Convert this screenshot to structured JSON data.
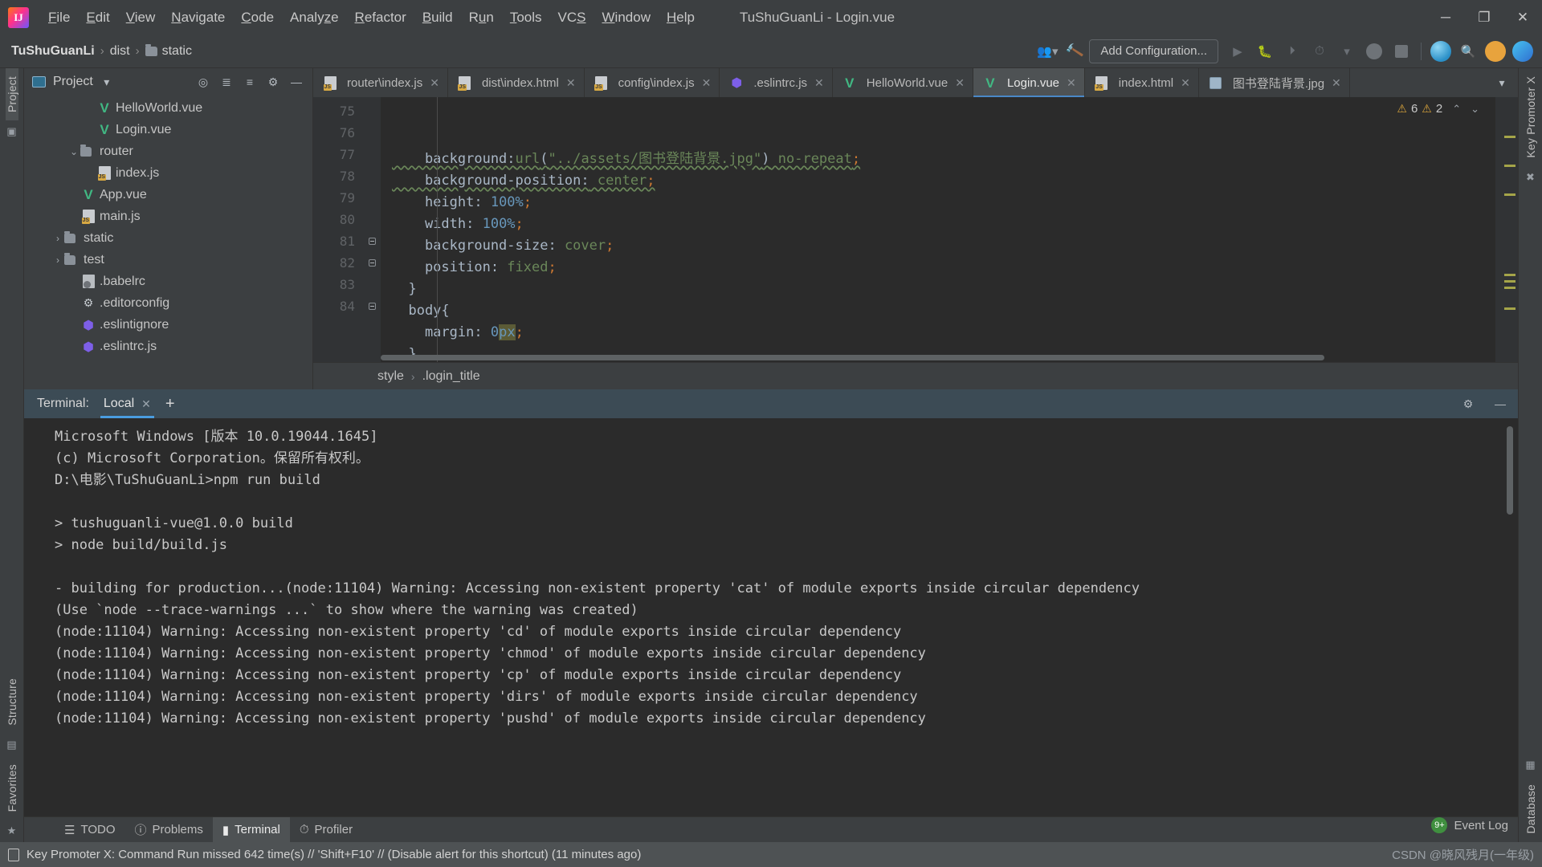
{
  "window": {
    "title": "TuShuGuanLi - Login.vue",
    "logo_text": "IJ",
    "minimize": "─",
    "maximize": "❐",
    "close": "✕"
  },
  "menu": {
    "items": [
      {
        "label": "File",
        "mnemonic": "F"
      },
      {
        "label": "Edit",
        "mnemonic": "E"
      },
      {
        "label": "View",
        "mnemonic": "V"
      },
      {
        "label": "Navigate",
        "mnemonic": "N"
      },
      {
        "label": "Code",
        "mnemonic": "C"
      },
      {
        "label": "Analyze",
        "mnemonic": "z"
      },
      {
        "label": "Refactor",
        "mnemonic": "R"
      },
      {
        "label": "Build",
        "mnemonic": "B"
      },
      {
        "label": "Run",
        "mnemonic": "u"
      },
      {
        "label": "Tools",
        "mnemonic": "T"
      },
      {
        "label": "VCS",
        "mnemonic": "S"
      },
      {
        "label": "Window",
        "mnemonic": "W"
      },
      {
        "label": "Help",
        "mnemonic": "H"
      }
    ]
  },
  "navbar": {
    "crumbs": [
      "TuShuGuanLi",
      "dist",
      "static"
    ],
    "add_configuration": "Add Configuration...",
    "icons": [
      "user-group-icon",
      "hammer-icon",
      "run-icon",
      "debug-icon",
      "coverage-icon",
      "profile-icon",
      "stop-icon",
      "search-icon",
      "update-icon",
      "settings-icon"
    ]
  },
  "left_rail": {
    "items": [
      "Project",
      "Structure",
      "Favorites"
    ]
  },
  "right_rail": {
    "items": [
      "Key Promoter X",
      "Database"
    ]
  },
  "project_panel": {
    "title": "Project",
    "tree": [
      {
        "label": "HelloWorld.vue",
        "icon": "vue-icon",
        "depth": 3,
        "arrow": ""
      },
      {
        "label": "Login.vue",
        "icon": "vue-icon",
        "depth": 3,
        "arrow": ""
      },
      {
        "label": "router",
        "icon": "folder-icon",
        "depth": 2,
        "arrow": "⌄"
      },
      {
        "label": "index.js",
        "icon": "js-icon",
        "depth": 3,
        "arrow": ""
      },
      {
        "label": "App.vue",
        "icon": "vue-icon",
        "depth": 2,
        "arrow": ""
      },
      {
        "label": "main.js",
        "icon": "js-icon",
        "depth": 2,
        "arrow": ""
      },
      {
        "label": "static",
        "icon": "folder-icon",
        "depth": 1,
        "arrow": "›"
      },
      {
        "label": "test",
        "icon": "folder-icon",
        "depth": 1,
        "arrow": "›"
      },
      {
        "label": ".babelrc",
        "icon": "babel-icon",
        "depth": 2,
        "arrow": ""
      },
      {
        "label": ".editorconfig",
        "icon": "gear-icon",
        "depth": 2,
        "arrow": ""
      },
      {
        "label": ".eslintignore",
        "icon": "eslint-icon",
        "depth": 2,
        "arrow": ""
      },
      {
        "label": ".eslintrc.js",
        "icon": "eslint-icon",
        "depth": 2,
        "arrow": ""
      }
    ]
  },
  "editor": {
    "tabs": [
      {
        "label": "router\\index.js",
        "icon": "js-icon",
        "active": false
      },
      {
        "label": "dist\\index.html",
        "icon": "html-icon",
        "active": false
      },
      {
        "label": "config\\index.js",
        "icon": "js-icon",
        "active": false
      },
      {
        "label": ".eslintrc.js",
        "icon": "eslint-icon",
        "active": false
      },
      {
        "label": "HelloWorld.vue",
        "icon": "vue-icon",
        "active": false
      },
      {
        "label": "Login.vue",
        "icon": "vue-icon",
        "active": true
      },
      {
        "label": "index.html",
        "icon": "html-icon",
        "active": false
      },
      {
        "label": "图书登陆背景.jpg",
        "icon": "image-icon",
        "active": false
      }
    ],
    "line_numbers": [
      "75",
      "76",
      "77",
      "78",
      "79",
      "80",
      "81",
      "82",
      "83",
      "84"
    ],
    "code_lines": [
      {
        "n": "75",
        "segments": [
          {
            "t": "    background:",
            "c": "c-prop"
          },
          {
            "t": "url",
            "c": "c-val"
          },
          {
            "t": "(",
            "c": "c-prop"
          },
          {
            "t": "\"../assets/图书登陆背景.jpg\"",
            "c": "c-str"
          },
          {
            "t": ")",
            "c": "c-prop"
          },
          {
            "t": " no-repeat",
            "c": "c-val"
          },
          {
            "t": ";",
            "c": "c-punc"
          }
        ]
      },
      {
        "n": "76",
        "segments": [
          {
            "t": "    background-position:",
            "c": "c-prop"
          },
          {
            "t": " center",
            "c": "c-val"
          },
          {
            "t": ";",
            "c": "c-punc"
          }
        ]
      },
      {
        "n": "77",
        "segments": [
          {
            "t": "    height:",
            "c": "c-prop"
          },
          {
            "t": " 100%",
            "c": "c-num"
          },
          {
            "t": ";",
            "c": "c-punc"
          }
        ]
      },
      {
        "n": "78",
        "segments": [
          {
            "t": "    width:",
            "c": "c-prop"
          },
          {
            "t": " 100%",
            "c": "c-num"
          },
          {
            "t": ";",
            "c": "c-punc"
          }
        ]
      },
      {
        "n": "79",
        "segments": [
          {
            "t": "    background-size:",
            "c": "c-prop"
          },
          {
            "t": " cover",
            "c": "c-val"
          },
          {
            "t": ";",
            "c": "c-punc"
          }
        ]
      },
      {
        "n": "80",
        "segments": [
          {
            "t": "    position:",
            "c": "c-prop"
          },
          {
            "t": " fixed",
            "c": "c-val"
          },
          {
            "t": ";",
            "c": "c-punc"
          }
        ]
      },
      {
        "n": "81",
        "segments": [
          {
            "t": "  }",
            "c": "c-prop"
          }
        ]
      },
      {
        "n": "82",
        "segments": [
          {
            "t": "  body{",
            "c": "c-prop"
          }
        ]
      },
      {
        "n": "83",
        "segments": [
          {
            "t": "    margin: ",
            "c": "c-prop"
          },
          {
            "t": "0",
            "c": "c-num"
          },
          {
            "t": "px",
            "c": "c-num hl-box"
          },
          {
            "t": ";",
            "c": "c-punc"
          }
        ]
      },
      {
        "n": "84",
        "segments": [
          {
            "t": "  }",
            "c": "c-prop"
          }
        ]
      }
    ],
    "warnings": {
      "warning_count": "6",
      "weak_warning_count": "2"
    },
    "breadcrumb": [
      "style",
      ".login_title"
    ]
  },
  "terminal": {
    "label": "Terminal:",
    "tab": "Local",
    "add": "+",
    "lines": [
      "Microsoft Windows [版本 10.0.19044.1645]",
      "(c) Microsoft Corporation。保留所有权利。",
      "D:\\电影\\TuShuGuanLi>npm run build",
      "",
      "> tushuguanli-vue@1.0.0 build",
      "> node build/build.js",
      "",
      "- building for production...(node:11104) Warning: Accessing non-existent property 'cat' of module exports inside circular dependency",
      "(Use `node --trace-warnings ...` to show where the warning was created)",
      "(node:11104) Warning: Accessing non-existent property 'cd' of module exports inside circular dependency",
      "(node:11104) Warning: Accessing non-existent property 'chmod' of module exports inside circular dependency",
      "(node:11104) Warning: Accessing non-existent property 'cp' of module exports inside circular dependency",
      "(node:11104) Warning: Accessing non-existent property 'dirs' of module exports inside circular dependency",
      "(node:11104) Warning: Accessing non-existent property 'pushd' of module exports inside circular dependency"
    ]
  },
  "tool_window_bar": {
    "buttons": [
      {
        "label": "TODO",
        "icon": "todo-icon",
        "active": false
      },
      {
        "label": "Problems",
        "icon": "problems-icon",
        "active": false
      },
      {
        "label": "Terminal",
        "icon": "terminal-icon",
        "active": true
      },
      {
        "label": "Profiler",
        "icon": "profiler-icon",
        "active": false
      }
    ],
    "event_log": "Event Log",
    "event_badge": "9+"
  },
  "status_bar": {
    "message": "Key Promoter X: Command Run missed 642 time(s) // 'Shift+F10' // (Disable alert for this shortcut) (11 minutes ago)",
    "watermark": "CSDN @晓风残月(一年级)"
  }
}
